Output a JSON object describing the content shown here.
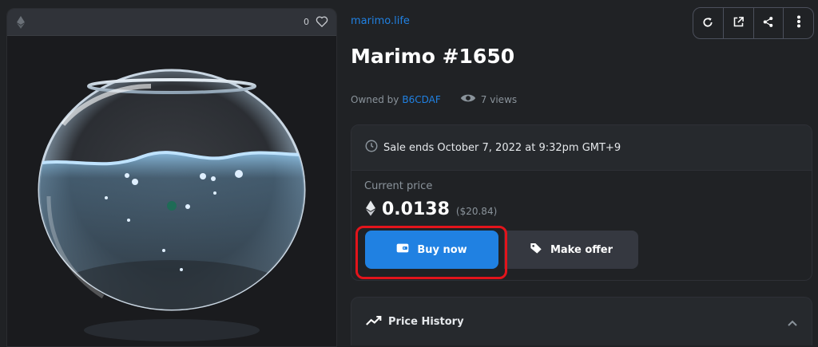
{
  "left_panel": {
    "favorite_count": "0",
    "icons": {
      "chain": "ethereum-icon",
      "favorite": "heart-outline-icon"
    }
  },
  "item": {
    "collection": "marimo.life",
    "name": "Marimo #1650",
    "owner_prefix": "Owned by",
    "owner": "B6CDAF",
    "views": "7 views"
  },
  "toolbar": {
    "icons": [
      "refresh-icon",
      "external-link-icon",
      "share-icon",
      "more-vertical-icon"
    ]
  },
  "sale": {
    "ends_text": "Sale ends October 7, 2022 at 9:32pm GMT+9",
    "current_price_label": "Current price",
    "price": "0.0138",
    "price_usd": "($20.84)",
    "buy_label": "Buy now",
    "offer_label": "Make offer"
  },
  "price_history": {
    "label": "Price History"
  },
  "colors": {
    "accent": "#2081e2",
    "highlight_outline": "#e3141b",
    "background": "#202225"
  }
}
